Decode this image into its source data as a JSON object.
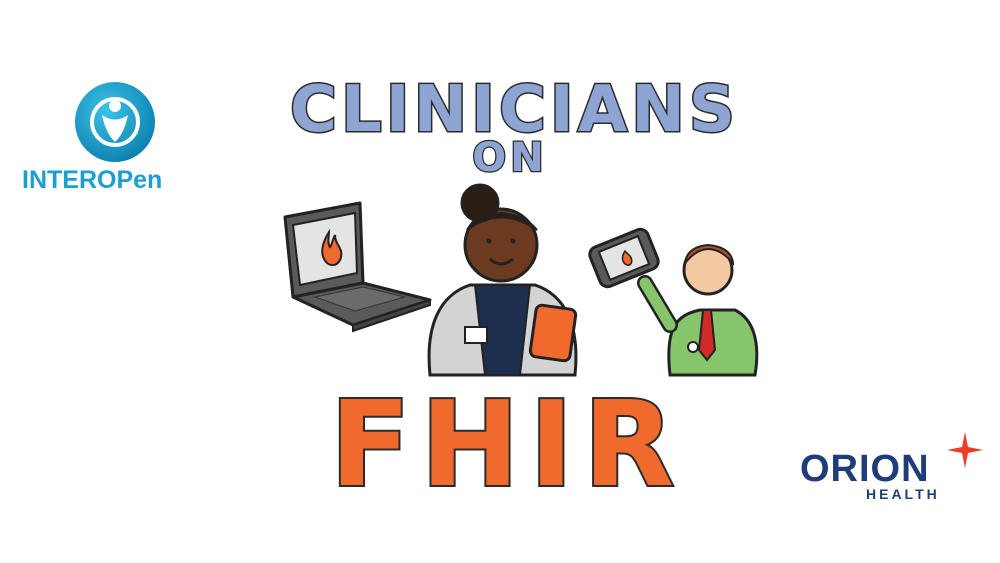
{
  "logos": {
    "interopen": {
      "text": "INTEROPen",
      "color": "#1a9fd0"
    },
    "orion": {
      "name": "ORION",
      "subtext": "HEALTH",
      "color": "#1f3d78",
      "star_color": "#ef3a24"
    }
  },
  "title": {
    "line1": "CLINICIANS",
    "line2": "ON",
    "line3": "FHIR",
    "line1_color": "#8ea5d4",
    "line3_color": "#ef6a2c"
  },
  "illustration": {
    "icons": [
      "laptop-fire-icon",
      "nurse-with-tablet",
      "doctor-with-tablet"
    ]
  }
}
